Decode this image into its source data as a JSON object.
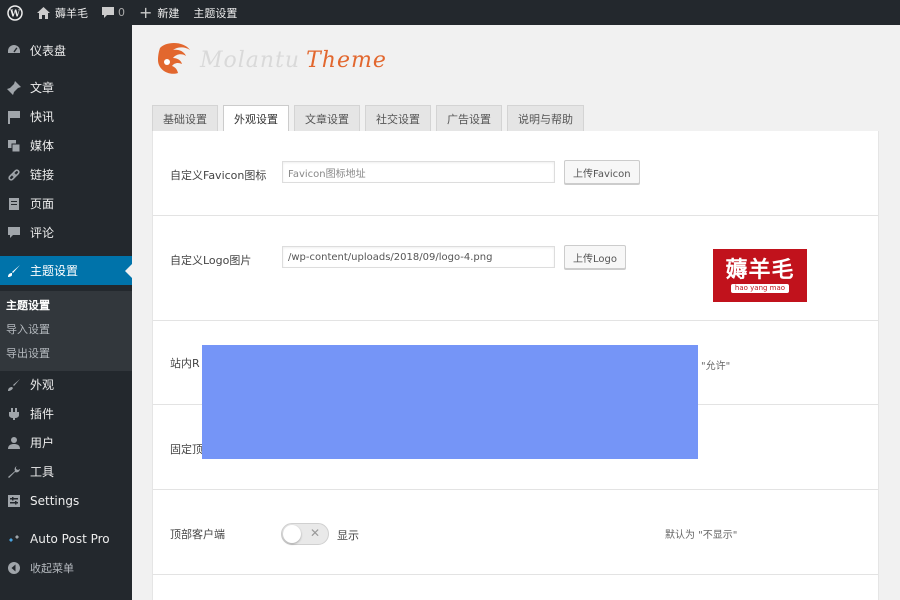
{
  "admin_bar": {
    "site_name": "薅羊毛",
    "comment_count": "0",
    "new_label": "新建",
    "theme_settings_label": "主题设置"
  },
  "sidebar": {
    "items": [
      {
        "label": "仪表盘",
        "icon": "dashboard-icon"
      },
      {
        "label": "文章",
        "icon": "pin-icon"
      },
      {
        "label": "快讯",
        "icon": "flag-icon"
      },
      {
        "label": "媒体",
        "icon": "media-icon"
      },
      {
        "label": "链接",
        "icon": "link-icon"
      },
      {
        "label": "页面",
        "icon": "page-icon"
      },
      {
        "label": "评论",
        "icon": "comment-icon"
      },
      {
        "label": "主题设置",
        "icon": "brush-icon",
        "active": true
      },
      {
        "label": "外观",
        "icon": "appearance-icon"
      },
      {
        "label": "插件",
        "icon": "plugin-icon"
      },
      {
        "label": "用户",
        "icon": "user-icon"
      },
      {
        "label": "工具",
        "icon": "wrench-icon"
      },
      {
        "label": "Settings",
        "icon": "settings-icon"
      },
      {
        "label": "Auto Post Pro",
        "icon": "star-icon"
      },
      {
        "label": "收起菜单",
        "icon": "collapse-icon"
      }
    ],
    "submenu": [
      "主题设置",
      "导入设置",
      "导出设置"
    ]
  },
  "theme_logo": {
    "brand": "Molantu",
    "suffix": "Theme"
  },
  "tabs": [
    "基础设置",
    "外观设置",
    "文章设置",
    "社交设置",
    "广告设置",
    "说明与帮助"
  ],
  "active_tab": 1,
  "fields": {
    "favicon": {
      "label": "自定义Favicon图标",
      "placeholder": "Favicon图标地址",
      "button": "上传Favicon"
    },
    "logo": {
      "label": "自定义Logo图片",
      "value": "/wp-content/uploads/2018/09/logo-4.png",
      "button": "上传Logo",
      "preview_main": "薅羊毛",
      "preview_sub": "hao yang mao"
    },
    "row3": {
      "label_visible": "站内R",
      "hint": "\"允许\""
    },
    "row4": {
      "label_visible": "固定顶"
    },
    "top_client": {
      "label": "顶部客户端",
      "toggle_text": "显示",
      "default_hint": "默认为 \"不显示\"",
      "enabled": false
    }
  },
  "colors": {
    "active_menu": "#0073aa",
    "sidebar_bg": "#23282d",
    "redaction": "#7595f7",
    "logo_preview_bg": "#c1121c",
    "brand_orange": "#e2672e"
  }
}
